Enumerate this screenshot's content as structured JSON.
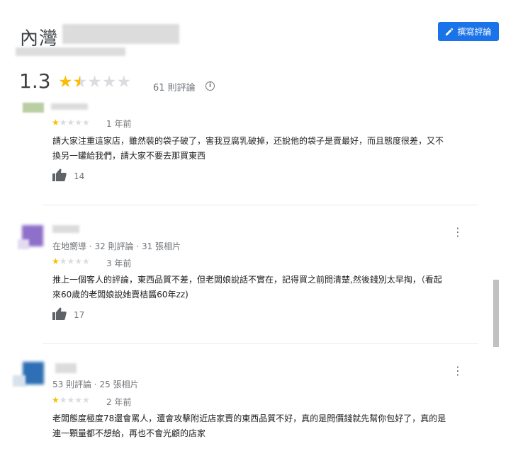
{
  "header": {
    "title": "內灣",
    "write_review_label": "撰寫評論",
    "write_review_icon": "pencil-icon"
  },
  "summary": {
    "rating": "1.3",
    "stars": 1.3,
    "review_count": "61 則評論"
  },
  "reviews": [
    {
      "stars": 1,
      "time": "1 年前",
      "text_line1": "請大家注重這家店，雖然裝的袋子破了，害我豆腐乳破掉，还說他的袋子是賣最好，而且態度很差，又不",
      "text_line2": "換另一罐給我們，請大家不要去那買東西",
      "likes": "14"
    },
    {
      "meta": "在地嚮導 · 32 則評論 · 31 張相片",
      "stars": 1,
      "time": "3 年前",
      "text_line1": "推上一個客人的評論，東西品質不差，但老闆娘說話不實在，記得買之前問清楚,然後錢別太早掏，（看起",
      "text_line2": "來60歲的老闆娘說她賣桔醬60年zz)",
      "likes": "17"
    },
    {
      "meta": "53 則評論 · 25 張相片",
      "stars": 1,
      "time": "2 年前",
      "text_line1": "老闆態度極度78還會罵人，還會攻擊附近店家賣的東西品質不好，真的是問價錢就先幫你包好了，真的是",
      "text_line2": "連一顆量都不想給，再也不會光顧的店家"
    }
  ]
}
